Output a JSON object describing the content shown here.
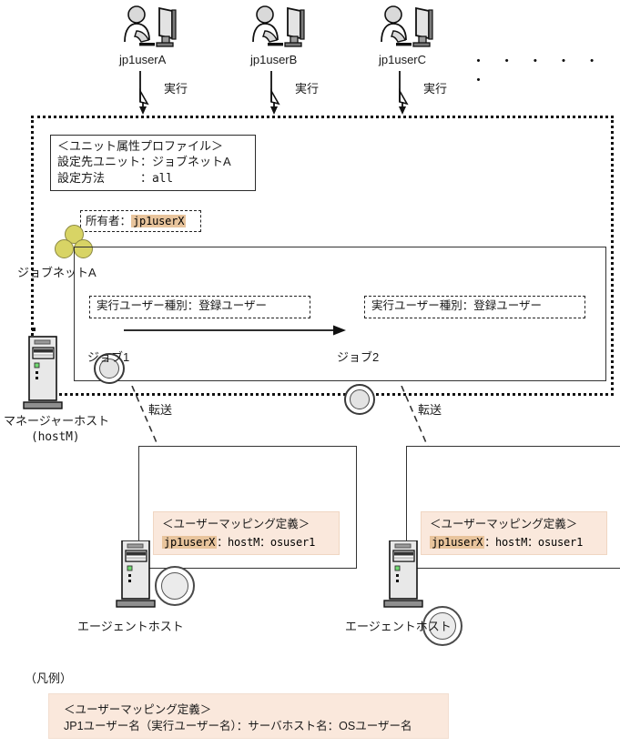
{
  "users": [
    {
      "id": "userA",
      "label": "jp1userA",
      "action": "実行"
    },
    {
      "id": "userB",
      "label": "jp1userB",
      "action": "実行"
    },
    {
      "id": "userC",
      "label": "jp1userC",
      "action": "実行"
    }
  ],
  "ellipsis": "・ ・ ・ ・ ・ ・",
  "manager": {
    "host_label": "マネージャーホスト",
    "host_name": "(hostM)",
    "profile": {
      "title": "＜ユニット属性プロファイル＞",
      "rows": [
        {
          "key": "設定先ユニット",
          "sep": "：",
          "value": "ジョブネットA"
        },
        {
          "key": "設定方法",
          "sep": "　　　：",
          "value": "all"
        }
      ]
    },
    "owner": {
      "label": "所有者：",
      "value": "jp1userX"
    },
    "jobnet_label": "ジョブネットA",
    "jobs": [
      {
        "id": "job1",
        "label": "ジョブ1",
        "annotation": "実行ユーザー種別：登録ユーザー"
      },
      {
        "id": "job2",
        "label": "ジョブ2",
        "annotation": "実行ユーザー種別：登録ユーザー"
      }
    ]
  },
  "transfers": [
    {
      "label": "転送"
    },
    {
      "label": "転送"
    }
  ],
  "agents": [
    {
      "id": "agent1",
      "host_label": "エージェントホスト",
      "mapping": {
        "title": "＜ユーザーマッピング定義＞",
        "jp1user": "jp1userX",
        "rest": "：hostM：osuser1"
      }
    },
    {
      "id": "agent2",
      "host_label": "エージェントホスト",
      "mapping": {
        "title": "＜ユーザーマッピング定義＞",
        "jp1user": "jp1userX",
        "rest": "：hostM：osuser1"
      }
    }
  ],
  "legend": {
    "caption": "（凡例）",
    "title": "＜ユーザーマッピング定義＞",
    "format": "JP1ユーザー名（実行ユーザー名）：サーバホスト名：OSユーザー名"
  },
  "colors": {
    "jobnet_circle": "#d8d465",
    "highlight_chip": "#e8c49c",
    "mapping_bg": "#fae8dc",
    "line": "#2b2b2b"
  }
}
